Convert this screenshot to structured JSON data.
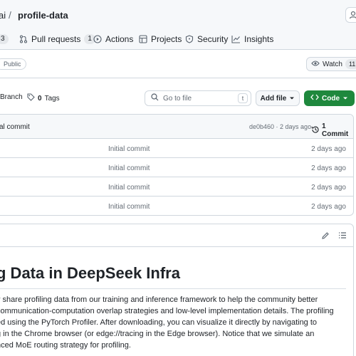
{
  "header": {
    "owner": "ai",
    "separator": "/",
    "repo": "profile-data"
  },
  "nav": {
    "issues_count": "3",
    "pull_requests": {
      "label": "Pull requests",
      "count": "1"
    },
    "actions": "Actions",
    "projects": "Projects",
    "security": "Security",
    "insights": "Insights"
  },
  "repo_meta": {
    "visibility": "Public",
    "watch": {
      "label": "Watch",
      "count": "11"
    }
  },
  "toolbar": {
    "branch_label": "Branch",
    "tags_label": "Tags",
    "tags_count": "0",
    "goto_placeholder": "Go to file",
    "goto_kbd": "t",
    "add_file": "Add file",
    "code": "Code"
  },
  "latest_commit": {
    "message": "al commit",
    "hash_time": "de0b460 · 2 days ago",
    "count_label": "1 Commit"
  },
  "files": [
    {
      "commit": "Initial commit",
      "date": "2 days ago"
    },
    {
      "commit": "Initial commit",
      "date": "2 days ago"
    },
    {
      "commit": "Initial commit",
      "date": "2 days ago"
    },
    {
      "commit": "Initial commit",
      "date": "2 days ago"
    }
  ],
  "readme": {
    "title": "g Data in DeepSeek Infra",
    "lines": [
      "y share profiling data from our training and inference framework to help the community better",
      "communication-computation overlap strategies and low-level implementation details. The profiling",
      "ed using the PyTorch Profiler. After downloading, you can visualize it directly by navigating to",
      "g in the Chrome browser (or edge://tracing in the Edge browser). Notice that we simulate an",
      "nced MoE routing strategy for profiling."
    ]
  },
  "colors": {
    "accent_green": "#1f883d",
    "border": "#d0d7de",
    "muted_text": "#656d76"
  },
  "icons": [
    "pull-request-icon",
    "actions-icon",
    "projects-icon",
    "security-icon",
    "insights-icon",
    "eye-icon",
    "tag-icon",
    "search-icon",
    "code-icon",
    "history-icon",
    "pencil-icon",
    "list-icon"
  ]
}
